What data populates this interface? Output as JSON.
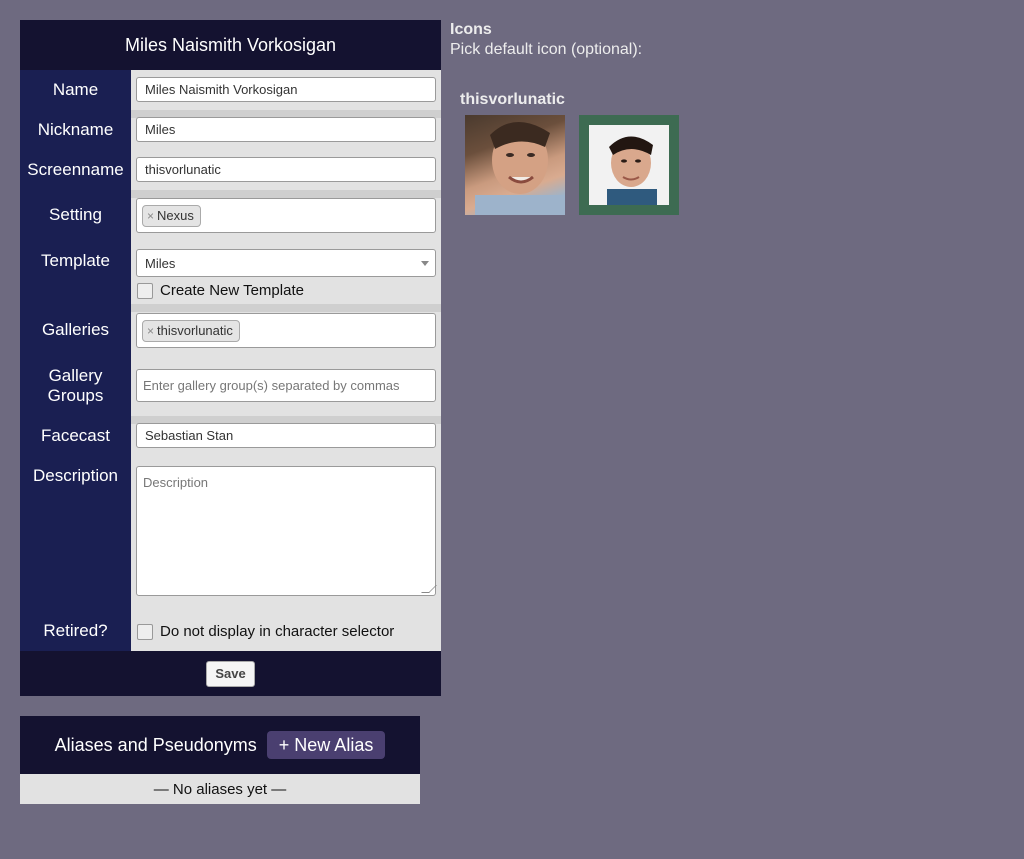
{
  "form": {
    "title": "Miles Naismith Vorkosigan",
    "name_label": "Name",
    "name_value": "Miles Naismith Vorkosigan",
    "nickname_label": "Nickname",
    "nickname_value": "Miles",
    "screenname_label": "Screenname",
    "screenname_value": "thisvorlunatic",
    "setting_label": "Setting",
    "setting_tag": "Nexus",
    "tag_remove": "×",
    "template_label": "Template",
    "template_value": "Miles",
    "create_template_label": "Create New Template",
    "galleries_label": "Galleries",
    "galleries_tag": "thisvorlunatic",
    "gallery_groups_label": "Gallery Groups",
    "gallery_groups_placeholder": "Enter gallery group(s) separated by commas",
    "facecast_label": "Facecast",
    "facecast_value": "Sebastian Stan",
    "description_label": "Description",
    "description_placeholder": "Description",
    "retired_label": "Retired?",
    "retired_checkbox_label": "Do not display in character selector",
    "save_label": "Save"
  },
  "icons": {
    "title": "Icons",
    "subtitle": "Pick default icon (optional):",
    "gallery_name": "thisvorlunatic",
    "items": [
      {
        "name": "icon-1",
        "selected": false
      },
      {
        "name": "icon-2",
        "selected": true
      }
    ],
    "selected_border_color": "#3d6b52"
  },
  "aliases": {
    "title": "Aliases and Pseudonyms",
    "new_alias_label": "+ New Alias",
    "empty_text": "— No aliases yet —"
  },
  "colors": {
    "page_bg": "#6e6a80",
    "header_bg": "#141230",
    "label_bg": "#1a1f52",
    "field_bg": "#e2e2e2",
    "button_accent": "#4a3f70"
  }
}
